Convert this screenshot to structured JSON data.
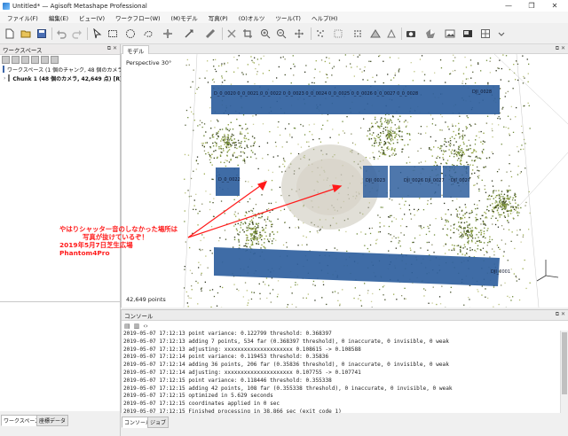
{
  "window": {
    "title": "Untitled* — Agisoft Metashape Professional",
    "minimize": "—",
    "restore": "❐",
    "close": "✕"
  },
  "menu": [
    "ファイル(F)",
    "編集(E)",
    "ビュー(V)",
    "ワークフロー(W)",
    "(M)モデル",
    "写真(P)",
    "(O)オルツ",
    "ツール(T)",
    "ヘルプ(H)"
  ],
  "toolbar_icons": [
    "new-icon",
    "open-icon",
    "save-icon",
    "undo-icon",
    "redo-icon",
    "navigate-icon",
    "rect-select-icon",
    "circle-select-icon",
    "free-select-icon",
    "move-object-icon",
    "rotate-object-icon",
    "ruler-icon",
    "delete-icon",
    "crop-icon",
    "zoom-in-icon",
    "zoom-out-icon",
    "reset-view-icon",
    "dots-icon",
    "shaded-icon",
    "wireframe-icon",
    "textured-icon",
    "camera-icon",
    "region-icon",
    "image-icon",
    "grid-icon"
  ],
  "workspace": {
    "header": "ワークスペース",
    "root": "ワークスペース (1 個のチャンク, 48 個のカメラ)",
    "chunk": "Chunk 1 (48 個のカメラ, 42,649 点) [R]",
    "tab_workspace": "ワークスペース",
    "tab_reference": "座標データ"
  },
  "model": {
    "tab": "モデル",
    "perspective": "Perspective 30°",
    "points": "42,649 points",
    "camera_labels": {
      "top": "D_0_0020  0_0_0021 0_0_0022 0_0_0023 0_0_0024 0_0_0025 0_0_0026 0_0_0027 0_0_0028",
      "top_right": "DJI_0028",
      "left": "D_0_0022",
      "center": "DJI_0023",
      "center2": "DJI_0026 DJI_0027",
      "bottom": "DJI_0001",
      "mid_right": "DJI_0027"
    }
  },
  "annotation": {
    "lines": [
      "やはりシャッター音のしなかった場所は",
      "写真が抜けているぞ！",
      "2019年5月7日芝生広場",
      "Phantom4Pro"
    ],
    "color": "#ff1a1a"
  },
  "console": {
    "header": "コンソール",
    "tab_console": "コンソール",
    "tab_jobs": "ジョブ",
    "lines": [
      "2019-05-07 17:12:13 point variance: 0.122799 threshold: 0.368397",
      "2019-05-07 17:12:13 adding 7 points, 534 far (0.368397 threshold), 0 inaccurate, 0 invisible, 0 weak",
      "2019-05-07 17:12:13 adjusting: xxxxxxxxxxxxxxxxxxxxx 0.108615 -> 0.108588",
      "2019-05-07 17:12:14 point variance: 0.119453 threshold: 0.35836",
      "2019-05-07 17:12:14 adding 36 points, 206 far (0.35836 threshold), 0 inaccurate, 0 invisible, 0 weak",
      "2019-05-07 17:12:14 adjusting: xxxxxxxxxxxxxxxxxxxxx 0.107755 -> 0.107741",
      "2019-05-07 17:12:15 point variance: 0.118446 threshold: 0.355338",
      "2019-05-07 17:12:15 adding 42 points, 108 far (0.355338 threshold), 0 inaccurate, 0 invisible, 0 weak",
      "2019-05-07 17:12:15 optimized in 5.629 seconds",
      "2019-05-07 17:12:15 coordinates applied in 0 sec",
      "2019-05-07 17:12:15 Finished processing in 38.866 sec (exit code 1)",
      ">>>"
    ]
  },
  "colors": {
    "camera_plane": "#2f5f9e",
    "accent": "#2a7bd0",
    "annotation": "#ff1a1a"
  }
}
